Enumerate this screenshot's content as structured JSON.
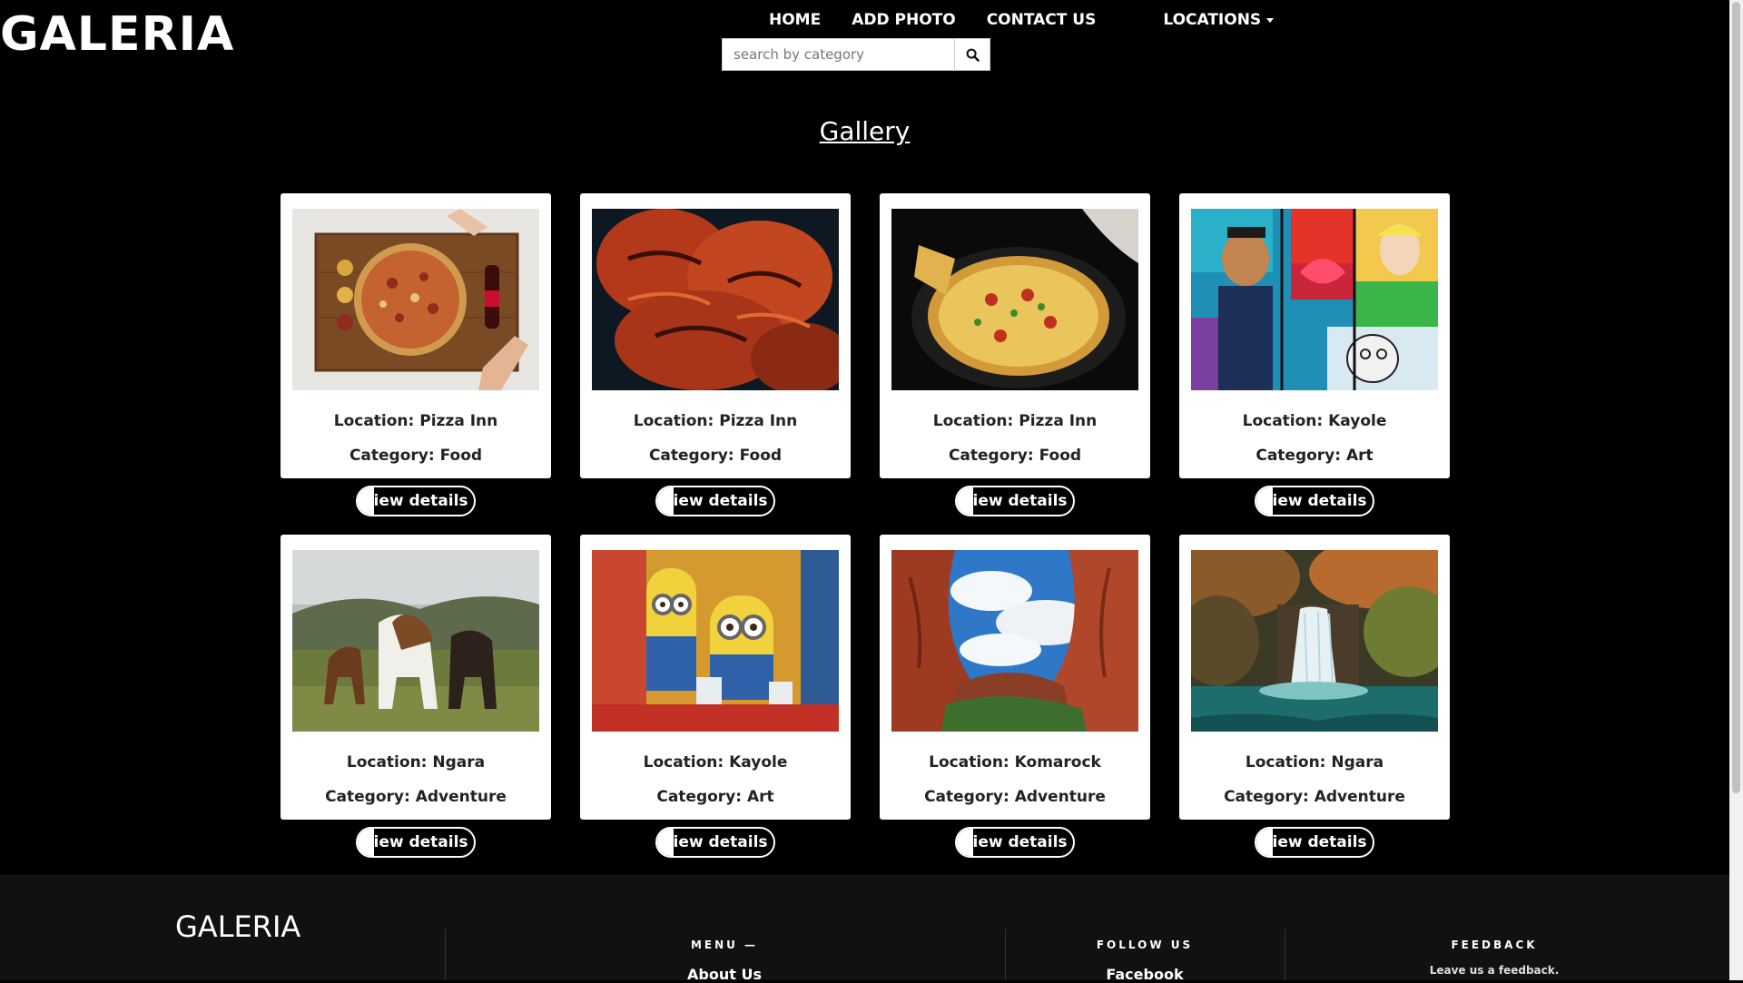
{
  "brand": "GALERIA",
  "nav": {
    "home": "HOME",
    "add_photo": "ADD PHOTO",
    "contact": "CONTACT US",
    "locations": "LOCATIONS"
  },
  "search": {
    "placeholder": "search by category"
  },
  "page_title": "Gallery",
  "cards": [
    {
      "location": "Location: Pizza Inn",
      "category": "Category: Food",
      "button": "view details",
      "image": "pizza-on-board"
    },
    {
      "location": "Location: Pizza Inn",
      "category": "Category: Food",
      "button": "view details",
      "image": "grilled-chicken"
    },
    {
      "location": "Location: Pizza Inn",
      "category": "Category: Food",
      "button": "view details",
      "image": "pan-pizza"
    },
    {
      "location": "Location: Kayole",
      "category": "Category: Art",
      "button": "view details",
      "image": "street-mural"
    },
    {
      "location": "Location: Ngara",
      "category": "Category: Adventure",
      "button": "view details",
      "image": "horses"
    },
    {
      "location": "Location: Kayole",
      "category": "Category: Art",
      "button": "view details",
      "image": "minions"
    },
    {
      "location": "Location: Komarock",
      "category": "Category: Adventure",
      "button": "view details",
      "image": "canyon"
    },
    {
      "location": "Location: Ngara",
      "category": "Category: Adventure",
      "button": "view details",
      "image": "waterfall"
    }
  ],
  "footer": {
    "brand": "GALERIA",
    "menu_heading": "MENU —",
    "menu_link": "About Us",
    "follow_heading": "FOLLOW US",
    "follow_link": "Facebook",
    "feedback_heading": "FEEDBACK",
    "feedback_text": "Leave us a feedback."
  },
  "colors": {
    "background": "#000000",
    "card": "#ffffff",
    "footer": "#111111"
  }
}
